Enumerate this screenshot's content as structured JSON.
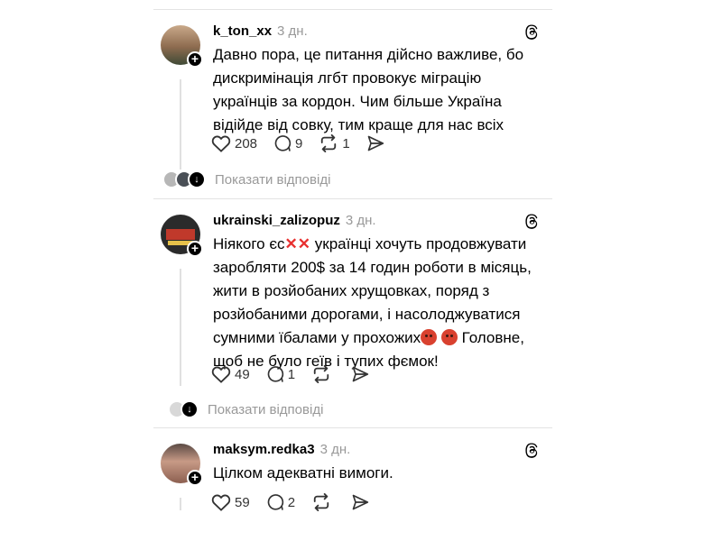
{
  "posts": [
    {
      "username": "k_ton_xx",
      "time": "3 дн.",
      "text": "Давно пора, це питання дійсно важливе, бо дискримінація лгбт провокує міграцію українців за кордон. Чим більше Україна відійде від совку, тим краще для нас всіх",
      "likes": "208",
      "comments": "9",
      "reposts": "1",
      "replies_label": "Показати відповіді"
    },
    {
      "username": "ukrainski_zalizopuz",
      "time": "3 дн.",
      "text_before": "Ніякого єс",
      "text_after": " українці хочуть продовжувати заробляти 200$ за 14 годин роботи в місяць, жити в розйобаних хрущовках, поряд з розйобаними дорогами, і насолоджуватися сумними їбалами у прохожих",
      "text_end": " Головне, щоб не було геїв і тупих фємок!",
      "crosses": "✕✕",
      "likes": "49",
      "comments": "1",
      "replies_label": "Показати відповіді"
    },
    {
      "username": "maksym.redka3",
      "time": "3 дн.",
      "text": "Цілком адекватні вимоги.",
      "likes": "59",
      "comments": "2"
    }
  ],
  "colors": {
    "accent_cross": "#e8302f",
    "muted": "#999999",
    "separator": "#e3e3e3"
  },
  "icons": [
    "heart-icon",
    "comment-icon",
    "repost-icon",
    "share-icon",
    "threads-logo-icon",
    "plus-icon",
    "arrow-down-icon"
  ]
}
